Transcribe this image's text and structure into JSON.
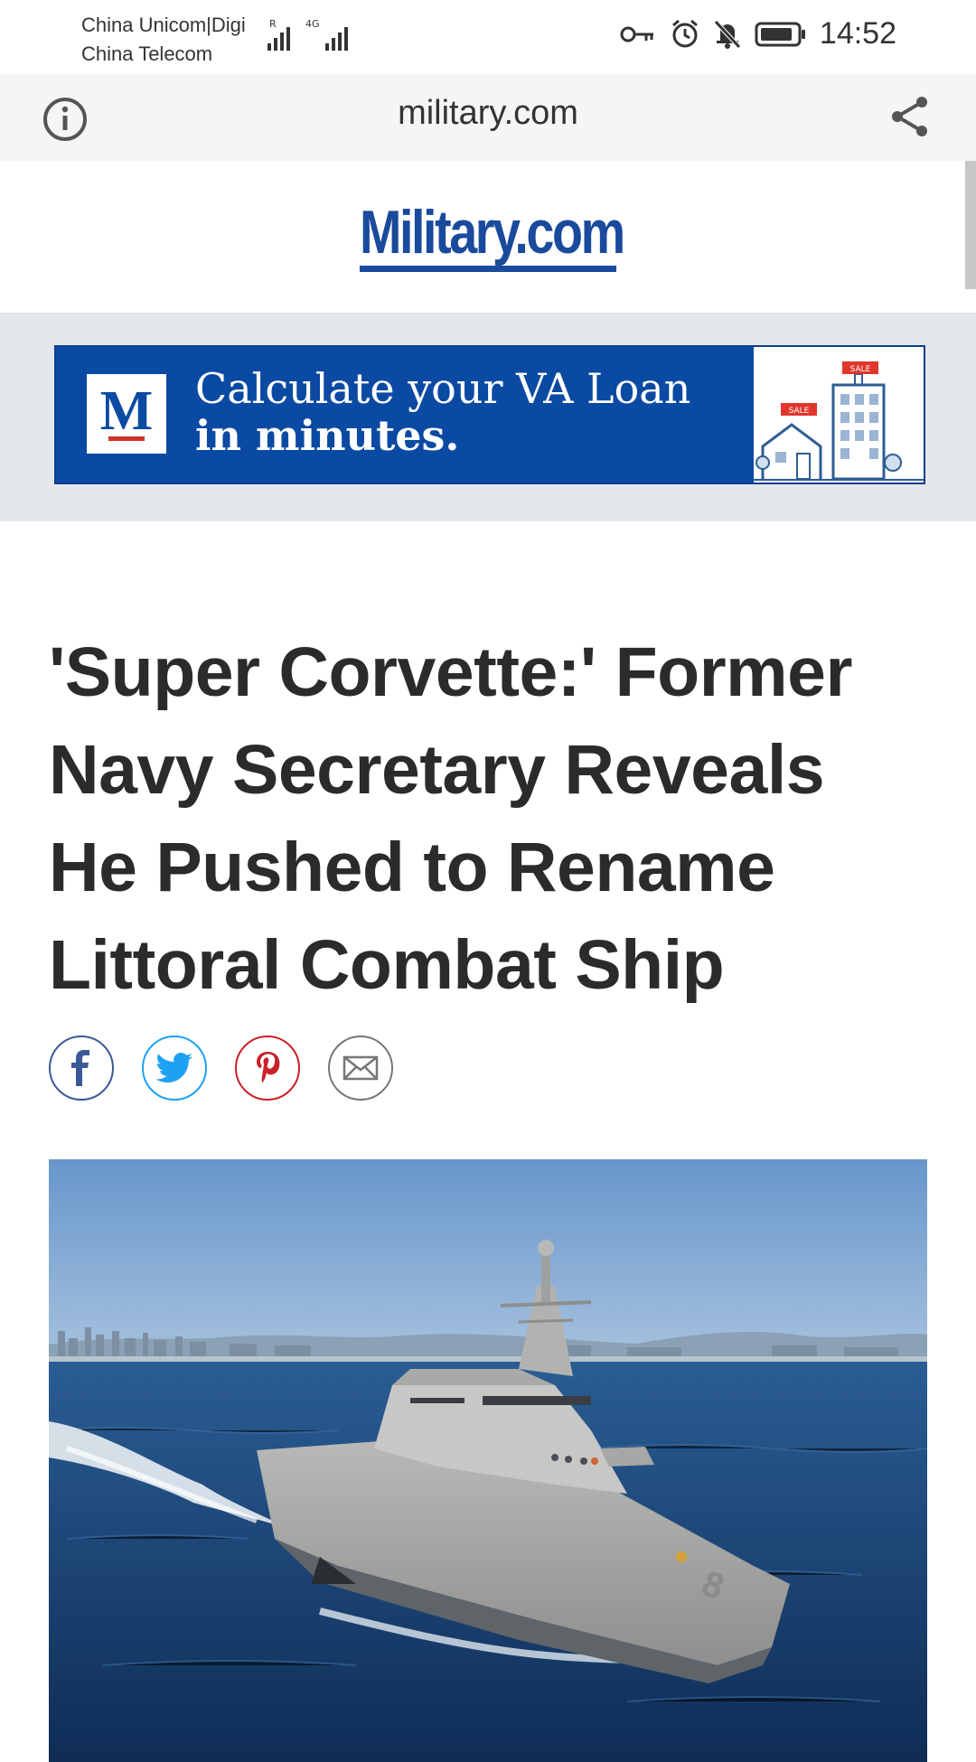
{
  "status_bar": {
    "carrier_1": "China Unicom|Digi",
    "carrier_2": "China Telecom",
    "signal_1_tag": "R",
    "signal_2_tag": "4G",
    "time": "14:52"
  },
  "browser": {
    "url_domain": "military.com"
  },
  "site": {
    "logo_text": "Military.com"
  },
  "ad": {
    "logo_letter": "M",
    "line1": "Calculate your VA Loan",
    "line2": "in minutes.",
    "sale_tag_1": "SALE",
    "sale_tag_2": "SALE"
  },
  "article": {
    "title": "'Super Corvette:' Former Navy Secretary Reveals He Pushed to Rename Littoral Combat Ship",
    "share_buttons": [
      {
        "name": "facebook",
        "color": "#3b5998"
      },
      {
        "name": "twitter",
        "color": "#1da1f2"
      },
      {
        "name": "pinterest",
        "color": "#cb2027"
      },
      {
        "name": "email",
        "color": "#777777"
      }
    ],
    "hull_number": "8"
  },
  "colors": {
    "brand_blue": "#1a4a9c",
    "ad_blue": "#0b4aa2",
    "ad_background": "#e4e7ec",
    "url_bar": "#f4f5f7"
  }
}
